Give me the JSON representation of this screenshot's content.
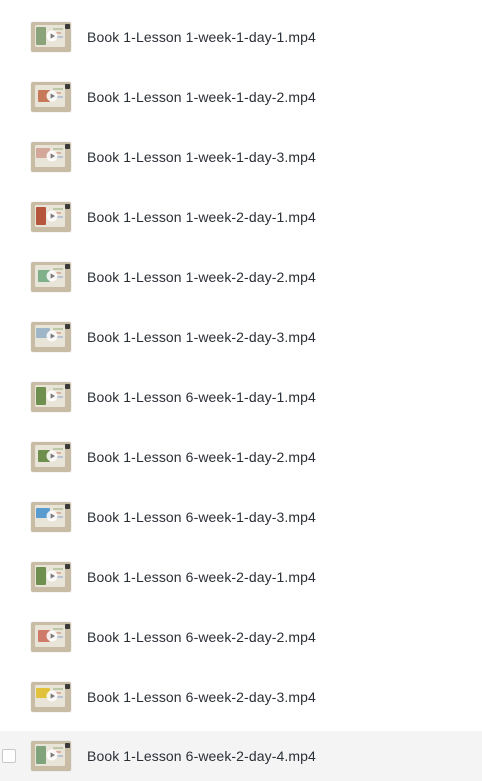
{
  "files": [
    {
      "name": "Book 1-Lesson 1-week-1-day-1.mp4",
      "thumb_icon": "video-thumbnail-icon",
      "thumb_color": "#8aa37a"
    },
    {
      "name": "Book 1-Lesson 1-week-1-day-2.mp4",
      "thumb_icon": "video-thumbnail-icon",
      "thumb_color": "#c77a5a"
    },
    {
      "name": "Book 1-Lesson 1-week-1-day-3.mp4",
      "thumb_icon": "video-thumbnail-icon",
      "thumb_color": "#d3a89a"
    },
    {
      "name": "Book 1-Lesson 1-week-2-day-1.mp4",
      "thumb_icon": "video-thumbnail-icon",
      "thumb_color": "#b5563c"
    },
    {
      "name": "Book 1-Lesson 1-week-2-day-2.mp4",
      "thumb_icon": "video-thumbnail-icon",
      "thumb_color": "#7fb08a"
    },
    {
      "name": "Book 1-Lesson 1-week-2-day-3.mp4",
      "thumb_icon": "video-thumbnail-icon",
      "thumb_color": "#9fb6c9"
    },
    {
      "name": "Book 1-Lesson 6-week-1-day-1.mp4",
      "thumb_icon": "video-thumbnail-icon",
      "thumb_color": "#6f8f4f"
    },
    {
      "name": "Book 1-Lesson 6-week-1-day-2.mp4",
      "thumb_icon": "video-thumbnail-icon",
      "thumb_color": "#6f8f4f"
    },
    {
      "name": "Book 1-Lesson 6-week-1-day-3.mp4",
      "thumb_icon": "video-thumbnail-icon",
      "thumb_color": "#5a9bd0"
    },
    {
      "name": "Book 1-Lesson 6-week-2-day-1.mp4",
      "thumb_icon": "video-thumbnail-icon",
      "thumb_color": "#6f8f4f"
    },
    {
      "name": "Book 1-Lesson 6-week-2-day-2.mp4",
      "thumb_icon": "video-thumbnail-icon",
      "thumb_color": "#d07a6a"
    },
    {
      "name": "Book 1-Lesson 6-week-2-day-3.mp4",
      "thumb_icon": "video-thumbnail-icon",
      "thumb_color": "#e2c23a"
    },
    {
      "name": "Book 1-Lesson 6-week-2-day-4.mp4",
      "thumb_icon": "video-thumbnail-icon",
      "thumb_color": "#7fa37a",
      "hovered": true
    }
  ],
  "colors": {
    "text": "#2a2f36",
    "hover_background": "#f4f4f5",
    "thumb_background": "#c9bca4"
  }
}
